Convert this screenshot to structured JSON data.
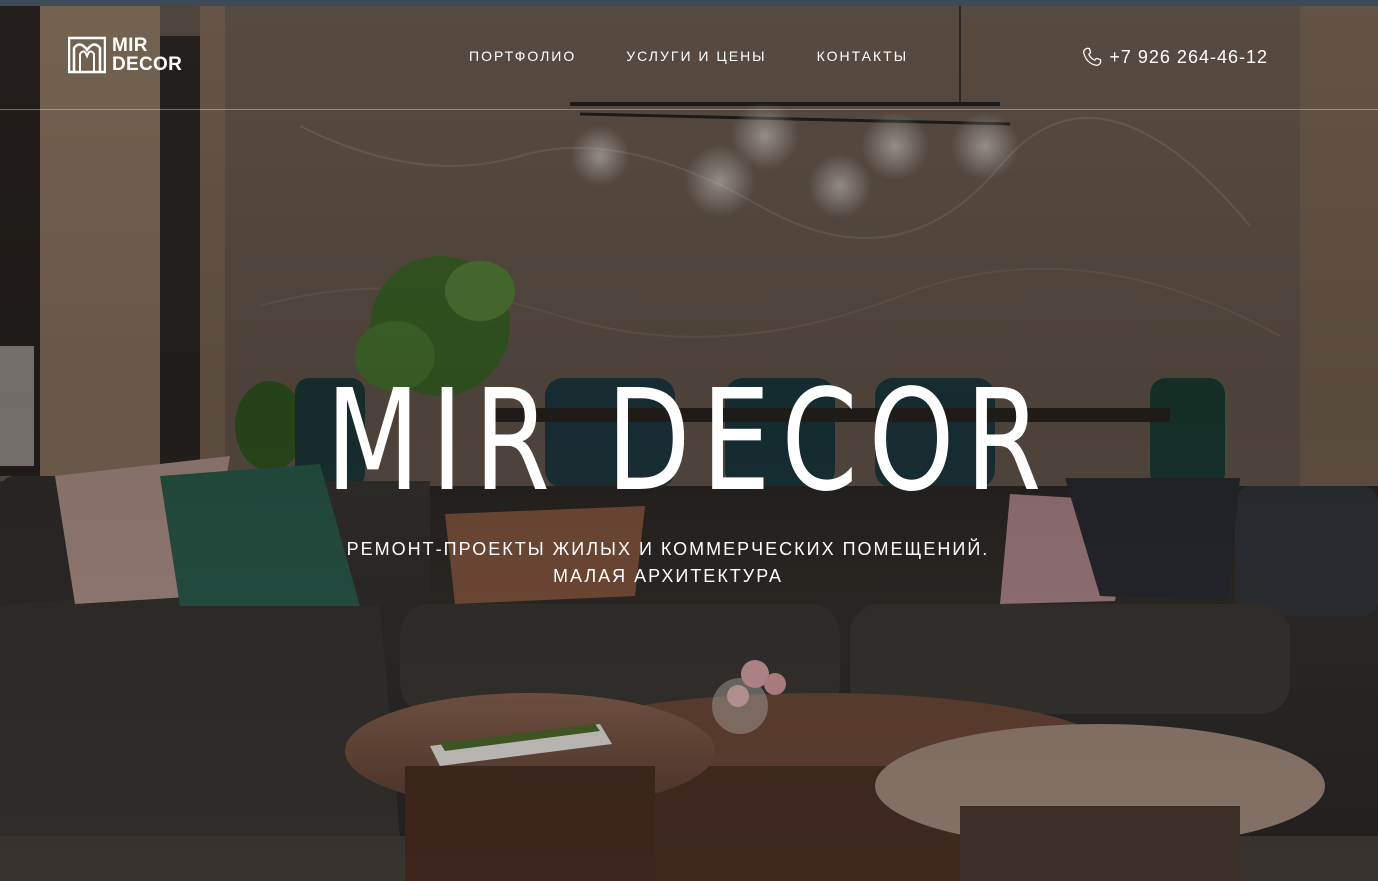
{
  "brand": {
    "logo_line1": "MIR",
    "logo_line2": "DECOR"
  },
  "nav": {
    "items": [
      {
        "label": "ПОРТФОЛИО"
      },
      {
        "label": "УСЛУГИ И ЦЕНЫ"
      },
      {
        "label": "КОНТАКТЫ"
      }
    ]
  },
  "contact": {
    "phone": "+7 926 264-46-12",
    "icon": "phone-icon"
  },
  "hero": {
    "title": "MIR DECOR",
    "subtitle": "РЕМОНТ-ПРОЕКТЫ ЖИЛЫХ И КОММЕРЧЕСКИХ ПОМЕЩЕНИЙ. МАЛАЯ АРХИТЕКТУРА"
  },
  "colors": {
    "text": "#ffffff",
    "top_strip": "#3e4a55"
  }
}
